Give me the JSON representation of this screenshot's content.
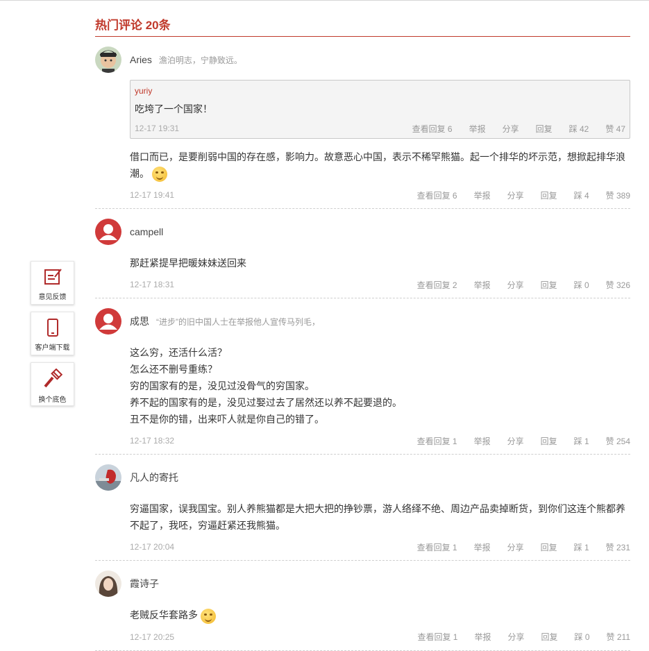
{
  "section": {
    "title": "热门评论 20条"
  },
  "side_tools": [
    {
      "label": "意见反馈",
      "icon": "feedback-icon"
    },
    {
      "label": "客户端下载",
      "icon": "mobile-icon"
    },
    {
      "label": "换个底色",
      "icon": "paint-brush-icon"
    }
  ],
  "actions": {
    "view": "查看回复",
    "report": "举报",
    "share": "分享",
    "reply": "回复",
    "down": "踩",
    "up": "赞"
  },
  "colors": {
    "accent": "#c0392b",
    "muted": "#999999"
  },
  "comments": [
    {
      "user": "Aries",
      "signature": "澹泊明志，宁静致远。",
      "quote": {
        "user": "yuriy",
        "text": "吃垮了一个国家！",
        "time": "12-17 19:31",
        "view": "查看回复 6",
        "down": "踩 42",
        "up": "赞 47"
      },
      "text": "借口而已，是要削弱中国的存在感，影响力。故意恶心中国，表示不稀罕熊猫。起一个排华的坏示范，想掀起排华浪潮。",
      "time": "12-17 19:41",
      "view": "查看回复 6",
      "down": "踩 4",
      "up": "赞 389"
    },
    {
      "user": "campell",
      "signature": "",
      "text": "那赶紧提早把暖妹妹送回来",
      "time": "12-17 18:31",
      "view": "查看回复 2",
      "down": "踩 0",
      "up": "赞 326"
    },
    {
      "user": "成思",
      "signature": "“进步”的旧中国人士在举报他人宣传马列毛，",
      "lines": [
        "这么穷，还活什么活？",
        "怎么还不删号重练？",
        "穷的国家有的是，没见过没骨气的穷国家。",
        "养不起的国家有的是，没见过娶过去了居然还以养不起要退的。",
        "丑不是你的错，出来吓人就是你自己的错了。"
      ],
      "time": "12-17 18:32",
      "view": "查看回复 1",
      "down": "踩 1",
      "up": "赞 254"
    },
    {
      "user": "凡人的寄托",
      "signature": "",
      "text": "穷逼国家，误我国宝。别人养熊猫都是大把大把的挣钞票，游人络绎不绝、周边产品卖掉断货，到你们这连个熊都养不起了，我呸，穷逼赶紧还我熊猫。",
      "time": "12-17 20:04",
      "view": "查看回复 1",
      "down": "踩 1",
      "up": "赞 231"
    },
    {
      "user": "霞诗子",
      "signature": "",
      "text": "老贼反华套路多",
      "time": "12-17 20:25",
      "view": "查看回复 1",
      "down": "踩 0",
      "up": "赞 211"
    }
  ]
}
